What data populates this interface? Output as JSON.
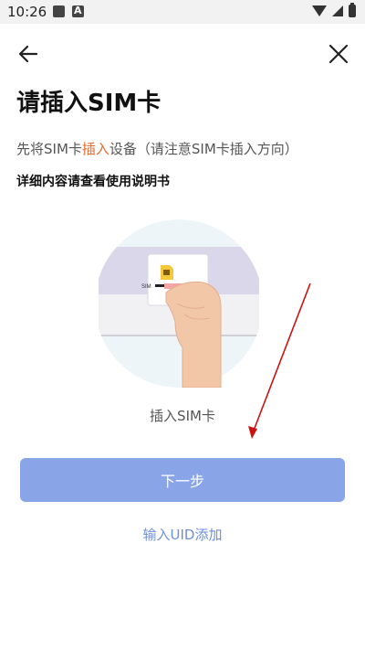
{
  "status_bar": {
    "time": "10:26",
    "left_icons": [
      "image-icon",
      "a-badge-icon"
    ],
    "right_icons": [
      "wifi-icon",
      "signal-icon",
      "battery-icon"
    ]
  },
  "header": {
    "back_icon": "arrow-left-icon",
    "close_icon": "close-icon"
  },
  "title": "请插入SIM卡",
  "instruction": {
    "prefix": "先将SIM卡",
    "highlight": "插入",
    "suffix": "设备（请注意SIM卡插入方向）",
    "highlight_color": "#e66a2c"
  },
  "manual_hint": "详细内容请查看使用说明书",
  "illustration": {
    "sim_label": "SIM",
    "caption": "插入SIM卡"
  },
  "next_button": {
    "label": "下一步",
    "color": "#8aa4e8"
  },
  "uid_link": {
    "label": "输入UID添加",
    "color": "#6e8fdc"
  },
  "annotation_arrow_color": "#cc1111"
}
